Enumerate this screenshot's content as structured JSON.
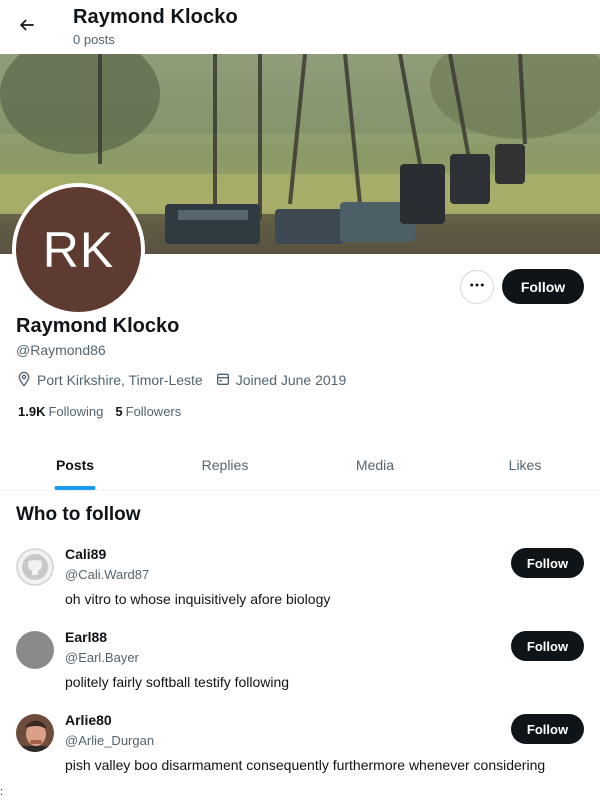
{
  "header": {
    "title": "Raymond Klocko",
    "subtitle": "0 posts"
  },
  "profile": {
    "avatar_initials": "RK",
    "avatar_color": "#5d3b31",
    "name": "Raymond Klocko",
    "handle": "@Raymond86",
    "location": "Port Kirkshire, Timor-Leste",
    "joined": "Joined June 2019",
    "following_count": "1.9K",
    "following_label": "Following",
    "followers_count": "5",
    "followers_label": "Followers",
    "follow_label": "Follow",
    "more_icon": "more-horizontal-icon"
  },
  "tabs": [
    {
      "label": "Posts",
      "active": true
    },
    {
      "label": "Replies",
      "active": false
    },
    {
      "label": "Media",
      "active": false
    },
    {
      "label": "Likes",
      "active": false
    }
  ],
  "who_to_follow": {
    "title": "Who to follow",
    "users": [
      {
        "name": "Cali89",
        "handle": "@Cali.Ward87",
        "bio": "oh vitro to whose inquisitively afore biology",
        "follow_label": "Follow",
        "avatar": "github-octocat-icon"
      },
      {
        "name": "Earl88",
        "handle": "@Earl.Bayer",
        "bio": "politely fairly softball testify following",
        "follow_label": "Follow",
        "avatar": "gray-circle"
      },
      {
        "name": "Arlie80",
        "handle": "@Arlie_Durgan",
        "bio": "pish valley boo disarmament consequently furthermore whenever considering",
        "follow_label": "Follow",
        "avatar": "photo"
      }
    ]
  },
  "stray_text": ":",
  "colors": {
    "accent": "#1d9bf0",
    "button": "#0f1419",
    "secondary_text": "#536471"
  }
}
